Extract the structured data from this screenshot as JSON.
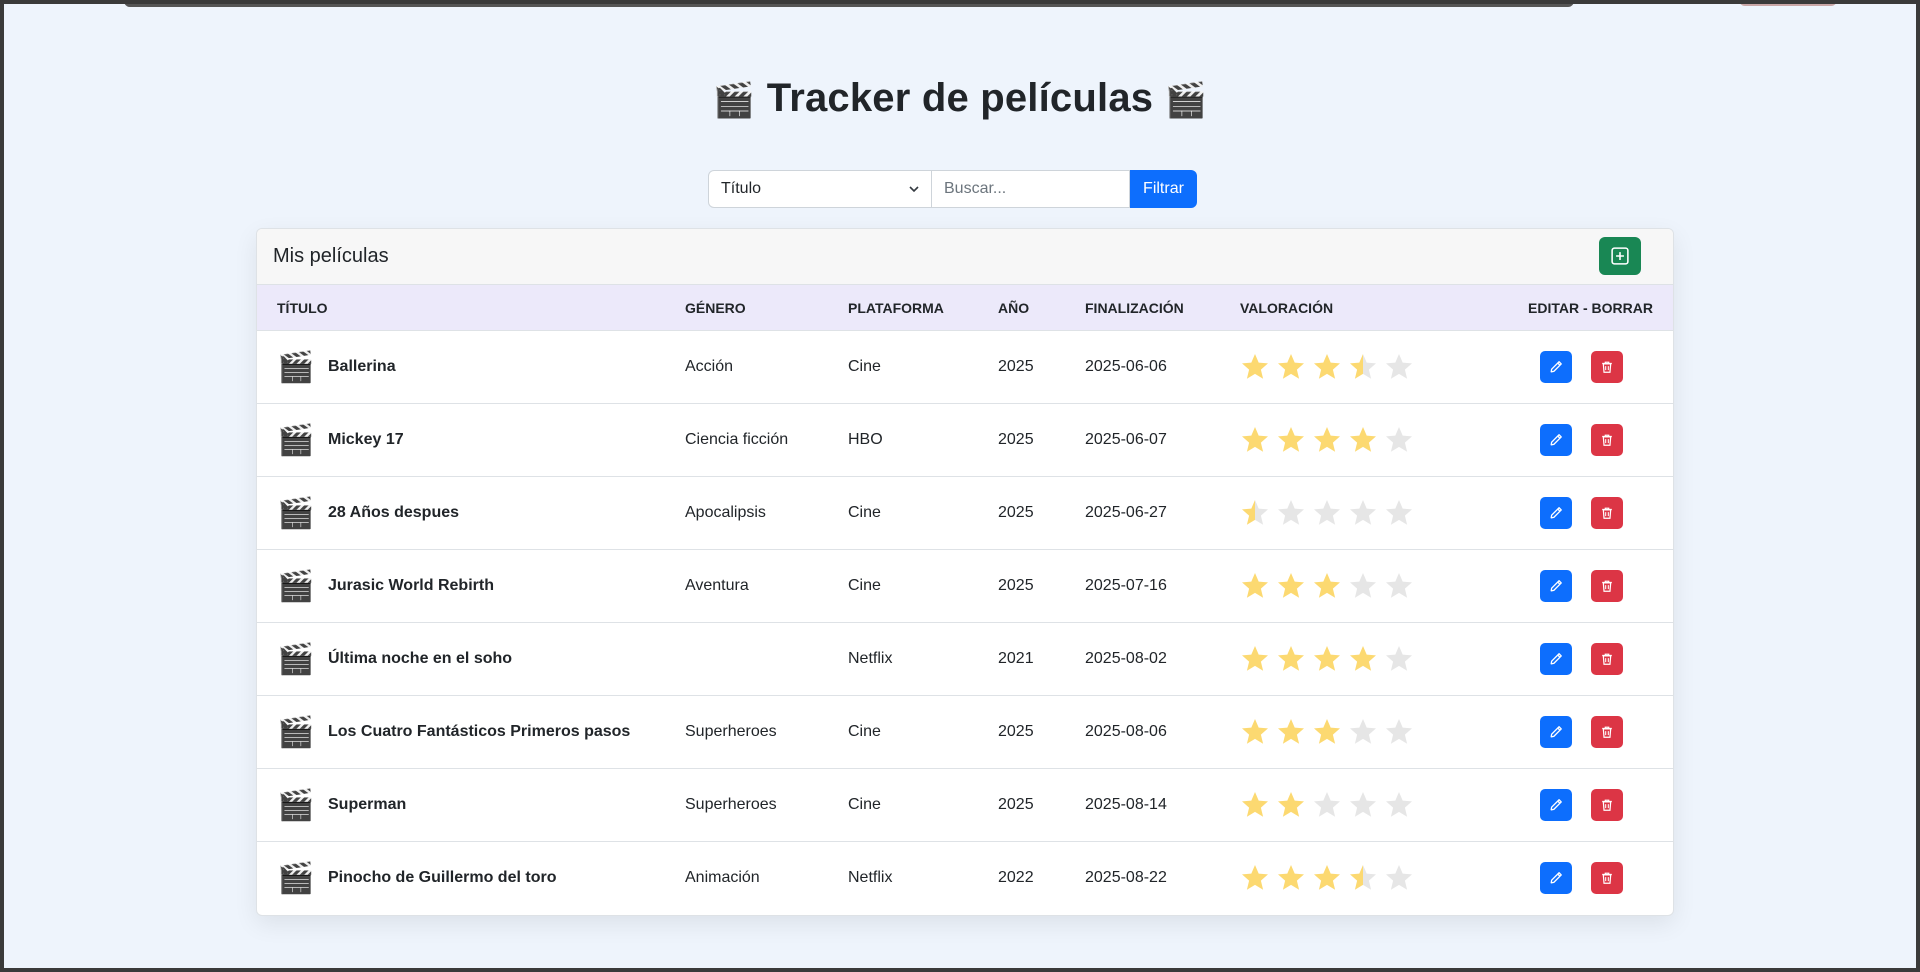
{
  "app": {
    "title": "Tracker de películas",
    "title_icon": "clapperboard-icon"
  },
  "filter": {
    "select_value": "Título",
    "search_placeholder": "Buscar...",
    "button_label": "Filtrar"
  },
  "card": {
    "title": "Mis películas",
    "add_icon": "plus-square-icon"
  },
  "table": {
    "headers": {
      "title": "TÍTULO",
      "genre": "GÉNERO",
      "platform": "PLATAFORMA",
      "year": "AÑO",
      "finished": "FINALIZACIÓN",
      "rating": "VALORACIÓN",
      "actions": "EDITAR - BORRAR"
    },
    "rows": [
      {
        "title": "Ballerina",
        "genre": "Acción",
        "platform": "Cine",
        "year": "2025",
        "finished": "2025-06-06",
        "rating": 3.5
      },
      {
        "title": "Mickey 17",
        "genre": "Ciencia ficción",
        "platform": "HBO",
        "year": "2025",
        "finished": "2025-06-07",
        "rating": 4
      },
      {
        "title": "28 Años despues",
        "genre": "Apocalipsis",
        "platform": "Cine",
        "year": "2025",
        "finished": "2025-06-27",
        "rating": 0.5
      },
      {
        "title": "Jurasic World Rebirth",
        "genre": "Aventura",
        "platform": "Cine",
        "year": "2025",
        "finished": "2025-07-16",
        "rating": 3
      },
      {
        "title": "Última noche en el soho",
        "genre": "",
        "platform": "Netflix",
        "year": "2021",
        "finished": "2025-08-02",
        "rating": 4
      },
      {
        "title": "Los Cuatro Fantásticos Primeros pasos",
        "genre": "Superheroes",
        "platform": "Cine",
        "year": "2025",
        "finished": "2025-08-06",
        "rating": 3
      },
      {
        "title": "Superman",
        "genre": "Superheroes",
        "platform": "Cine",
        "year": "2025",
        "finished": "2025-08-14",
        "rating": 2
      },
      {
        "title": "Pinocho de Guillermo del toro",
        "genre": "Animación",
        "platform": "Netflix",
        "year": "2022",
        "finished": "2025-08-22",
        "rating": 3.5
      }
    ],
    "rating_max": 5
  },
  "colors": {
    "star_filled": "#fcd971",
    "star_empty": "#e6e6e6",
    "primary": "#0d6efd",
    "danger": "#dc3545",
    "success": "#198754"
  },
  "icons": {
    "row_icon": "clapperboard-icon",
    "edit_icon": "pencil-icon",
    "delete_icon": "trash-icon"
  }
}
